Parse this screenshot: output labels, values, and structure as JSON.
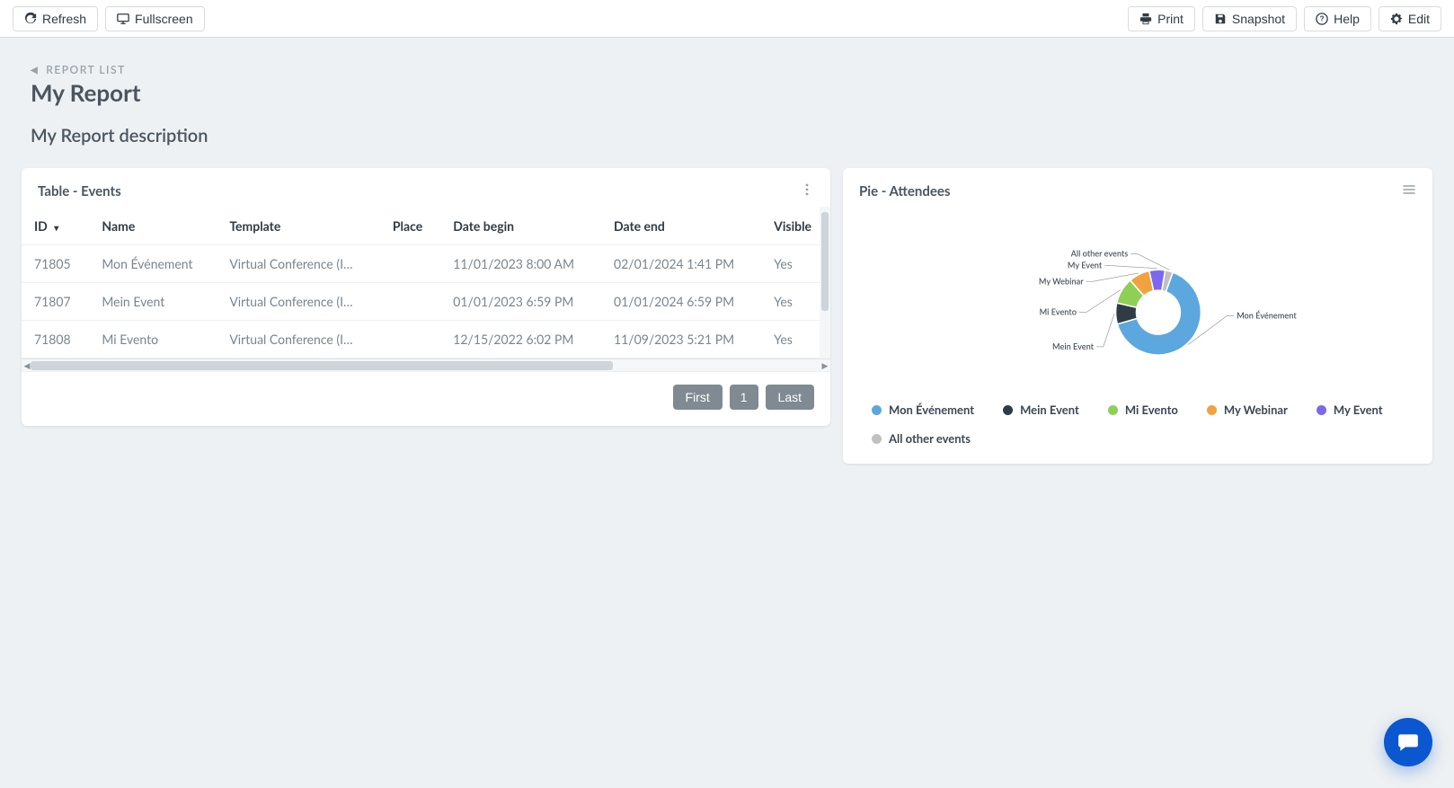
{
  "toolbar": {
    "left": {
      "refresh": "Refresh",
      "fullscreen": "Fullscreen"
    },
    "right": {
      "print": "Print",
      "snapshot": "Snapshot",
      "help": "Help",
      "edit": "Edit"
    }
  },
  "breadcrumb": {
    "label": "REPORT LIST"
  },
  "page": {
    "title": "My Report",
    "description": "My Report description"
  },
  "table_card": {
    "title": "Table - Events",
    "columns": {
      "id": "ID",
      "name": "Name",
      "template": "Template",
      "place": "Place",
      "date_begin": "Date begin",
      "date_end": "Date end",
      "visible": "Visible"
    },
    "rows": [
      {
        "id": "71805",
        "name": "Mon Événement",
        "template": "Virtual Conference (I…",
        "place": "",
        "date_begin": "11/01/2023 8:00 AM",
        "date_end": "02/01/2024 1:41 PM",
        "visible": "Yes"
      },
      {
        "id": "71807",
        "name": "Mein Event",
        "template": "Virtual Conference (I…",
        "place": "",
        "date_begin": "01/01/2023 6:59 PM",
        "date_end": "01/01/2024 6:59 PM",
        "visible": "Yes"
      },
      {
        "id": "71808",
        "name": "Mi Evento",
        "template": "Virtual Conference (I…",
        "place": "",
        "date_begin": "12/15/2022 6:02 PM",
        "date_end": "11/09/2023 5:21 PM",
        "visible": "Yes"
      }
    ],
    "pager": {
      "first": "First",
      "page": "1",
      "last": "Last"
    }
  },
  "pie_card": {
    "title": "Pie - Attendees",
    "labels": {
      "mon_evenement": "Mon Événement",
      "mein_event": "Mein Event",
      "mi_evento": "Mi Evento",
      "my_webinar": "My Webinar",
      "my_event": "My Event",
      "all_other": "All other events"
    },
    "legend": [
      {
        "key": "mon_evenement",
        "label": "Mon Événement",
        "color": "#5ba7de"
      },
      {
        "key": "mein_event",
        "label": "Mein Event",
        "color": "#2f3b45"
      },
      {
        "key": "mi_evento",
        "label": "Mi Evento",
        "color": "#8ed056"
      },
      {
        "key": "my_webinar",
        "label": "My Webinar",
        "color": "#f0a23f"
      },
      {
        "key": "my_event",
        "label": "My Event",
        "color": "#7b68ee"
      },
      {
        "key": "all_other",
        "label": "All other events",
        "color": "#c0c0c0"
      }
    ]
  },
  "chart_data": {
    "type": "pie",
    "title": "Pie - Attendees",
    "series": [
      {
        "name": "Mon Événement",
        "value": 65,
        "color": "#5ba7de"
      },
      {
        "name": "Mein Event",
        "value": 8,
        "color": "#2f3b45"
      },
      {
        "name": "Mi Evento",
        "value": 10,
        "color": "#8ed056"
      },
      {
        "name": "My Webinar",
        "value": 8,
        "color": "#f0a23f"
      },
      {
        "name": "My Event",
        "value": 6,
        "color": "#7b68ee"
      },
      {
        "name": "All other events",
        "value": 3,
        "color": "#c0c0c0"
      }
    ],
    "donut_inner_ratio": 0.5
  }
}
